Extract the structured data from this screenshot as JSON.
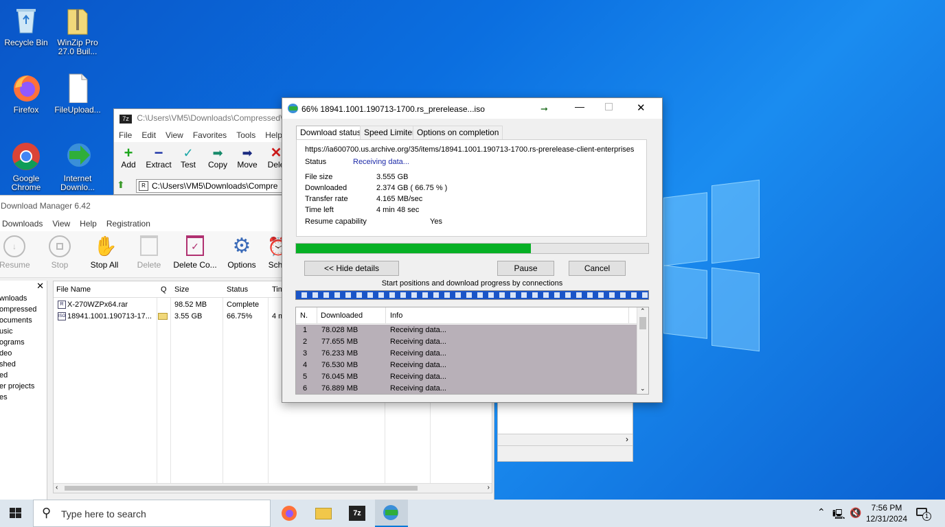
{
  "desktop": {
    "icons": [
      {
        "label": "Recycle Bin"
      },
      {
        "label": "WinZip Pro 27.0 Buil..."
      },
      {
        "label": "Firefox"
      },
      {
        "label": "FileUpload..."
      },
      {
        "label": "Google Chrome"
      },
      {
        "label": "Internet Downlo..."
      }
    ]
  },
  "zip": {
    "title": "C:\\Users\\VM5\\Downloads\\Compressed\\",
    "menu": [
      "File",
      "Edit",
      "View",
      "Favorites",
      "Tools",
      "Help"
    ],
    "toolbar": [
      "Add",
      "Extract",
      "Test",
      "Copy",
      "Move",
      "Dele"
    ],
    "path": "C:\\Users\\VM5\\Downloads\\Compre"
  },
  "idm": {
    "title": "Download Manager 6.42",
    "menu": [
      "Downloads",
      "View",
      "Help",
      "Registration"
    ],
    "toolbar": [
      "Resume",
      "Stop",
      "Stop All",
      "Delete",
      "Delete Co...",
      "Options",
      "Sch"
    ],
    "sidebar": [
      "wnloads",
      "ompressed",
      "ocuments",
      "usic",
      "ograms",
      "deo",
      "shed",
      "ed",
      "er projects",
      "es"
    ],
    "columns": [
      "File Name",
      "Q",
      "Size",
      "Status",
      "Tim"
    ],
    "rows": [
      {
        "name": "X-270WZPx64.rar",
        "size": "98.52  MB",
        "status": "Complete",
        "time": ""
      },
      {
        "name": "18941.1001.190713-17...",
        "size": "3.55  GB",
        "status": "66.75%",
        "time": "4 m"
      }
    ]
  },
  "dialog": {
    "title": "66% 18941.1001.190713-1700.rs_prerelease...iso",
    "tabs": [
      "Download status",
      "Speed Limiter",
      "Options on completion"
    ],
    "url": "https://ia600700.us.archive.org/35/items/18941.1001.190713-1700.rs-prerelease-client-enterprises",
    "status_label": "Status",
    "status_value": "Receiving data...",
    "fields": [
      {
        "label": "File size",
        "value": "3.555  GB"
      },
      {
        "label": "Downloaded",
        "value": "2.374  GB  ( 66.75 % )"
      },
      {
        "label": "Transfer rate",
        "value": "4.165  MB/sec"
      },
      {
        "label": "Time left",
        "value": "4 min 48 sec"
      }
    ],
    "resume_label": "Resume capability",
    "resume_value": "Yes",
    "progress": 0.6675,
    "hide_details": "<< Hide details",
    "pause": "Pause",
    "cancel": "Cancel",
    "connections_caption": "Start positions and download progress by connections",
    "columns": [
      "N.",
      "Downloaded",
      "Info"
    ],
    "connections": [
      {
        "n": "1",
        "downloaded": "78.028  MB",
        "info": "Receiving data..."
      },
      {
        "n": "2",
        "downloaded": "77.655  MB",
        "info": "Receiving data..."
      },
      {
        "n": "3",
        "downloaded": "76.233  MB",
        "info": "Receiving data..."
      },
      {
        "n": "4",
        "downloaded": "76.530  MB",
        "info": "Receiving data..."
      },
      {
        "n": "5",
        "downloaded": "76.045  MB",
        "info": "Receiving data..."
      },
      {
        "n": "6",
        "downloaded": "76.889  MB",
        "info": "Receiving data..."
      }
    ]
  },
  "taskbar": {
    "search_placeholder": "Type here to search",
    "time": "7:56 PM",
    "date": "12/31/2024",
    "notification_count": "1"
  },
  "colors": {
    "progress": "#06b025",
    "accent": "#0078d7",
    "status_value": "#1c2aa8"
  }
}
